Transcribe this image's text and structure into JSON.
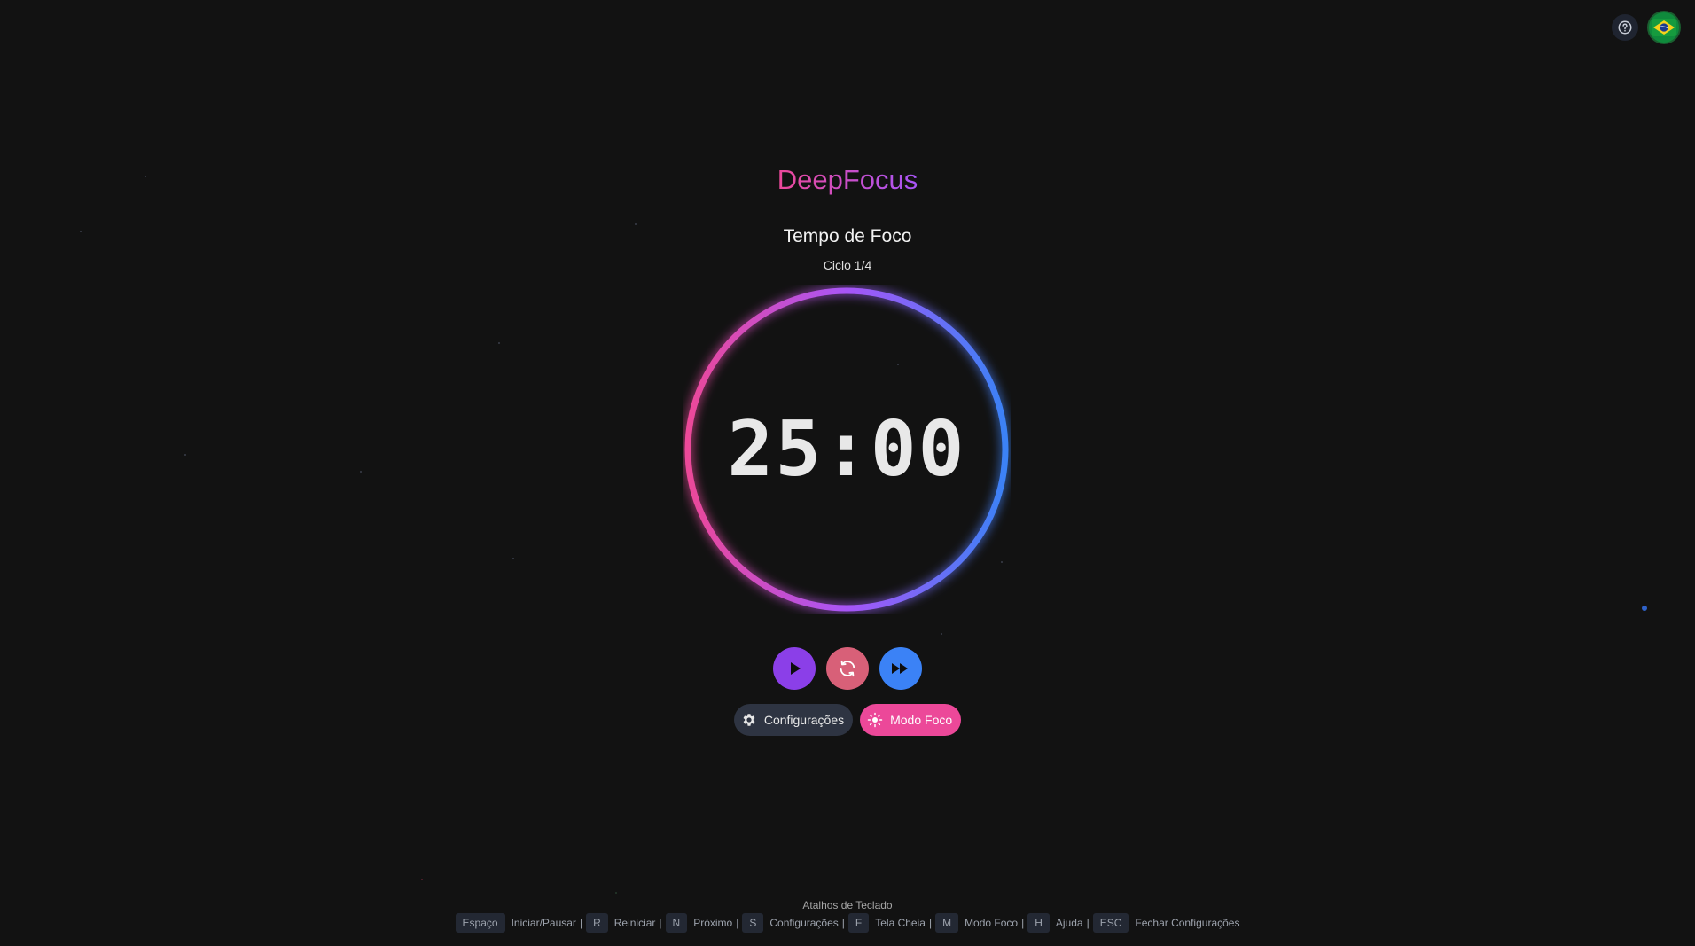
{
  "app": {
    "title": "DeepFocus",
    "mode_label": "Tempo de Foco",
    "cycle_label": "Ciclo 1/4",
    "time": "25:00",
    "progress": 1.0
  },
  "header": {
    "help_icon": "question-circle-icon",
    "language_icon": "brazil-flag-icon"
  },
  "controls": {
    "play_icon": "play-icon",
    "reset_icon": "refresh-icon",
    "skip_icon": "fast-forward-icon"
  },
  "actions": {
    "settings_label": "Configurações",
    "focus_mode_label": "Modo Foco"
  },
  "shortcuts": {
    "title": "Atalhos de Teclado",
    "items": [
      {
        "key": "Espaço",
        "label": "Iniciar/Pausar"
      },
      {
        "key": "R",
        "label": "Reiniciar"
      },
      {
        "key": "N",
        "label": "Próximo"
      },
      {
        "key": "S",
        "label": "Configurações"
      },
      {
        "key": "F",
        "label": "Tela Cheia"
      },
      {
        "key": "M",
        "label": "Modo Foco"
      },
      {
        "key": "H",
        "label": "Ajuda"
      },
      {
        "key": "ESC",
        "label": "Fechar Configurações"
      }
    ]
  },
  "colors": {
    "background": "#121212",
    "accent_pink": "#ec4899",
    "accent_purple": "#a855f7",
    "accent_blue": "#3b82f6",
    "reset_button": "#d86078",
    "settings_button": "#2e3442"
  }
}
